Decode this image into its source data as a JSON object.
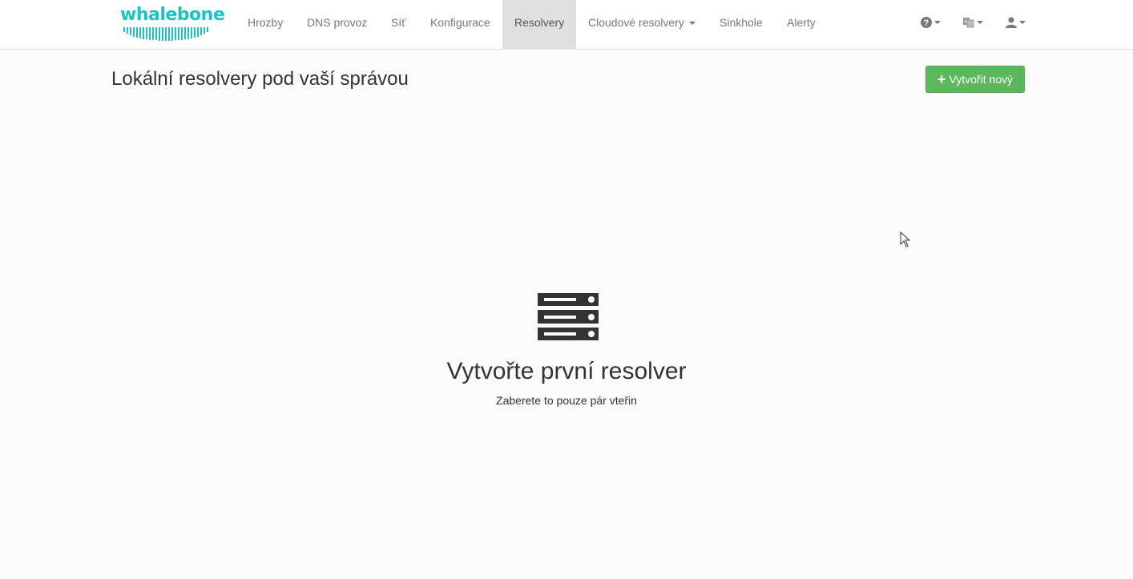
{
  "brand": {
    "name": "whalebone",
    "color": "#1ec2c2"
  },
  "nav": {
    "items": [
      {
        "label": "Hrozby"
      },
      {
        "label": "DNS provoz"
      },
      {
        "label": "Síť"
      },
      {
        "label": "Konfigurace"
      },
      {
        "label": "Resolvery",
        "active": true
      },
      {
        "label": "Cloudové resolvery",
        "dropdown": true
      },
      {
        "label": "Sinkhole"
      },
      {
        "label": "Alerty"
      }
    ],
    "icons": [
      "help-icon",
      "language-icon",
      "user-icon"
    ]
  },
  "page": {
    "title": "Lokální resolvery pod vaší správou",
    "create_button": "Vytvořit nový",
    "create_button_color": "#5cb85c"
  },
  "empty_state": {
    "icon": "server-icon",
    "title": "Vytvořte první resolver",
    "subtitle": "Zaberete to pouze pár vteřin"
  }
}
